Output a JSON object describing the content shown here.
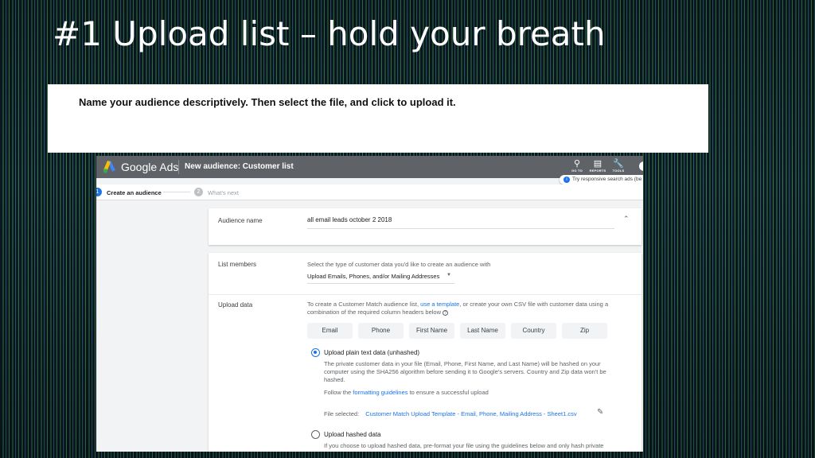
{
  "slide": {
    "title": "#1 Upload list – hold your breath",
    "instruction": "Name your audience descriptively.  Then select the file, and click to upload it."
  },
  "app": {
    "brand": "Google Ads",
    "page_title": "New audience: Customer list",
    "tools": [
      {
        "icon": "search-icon",
        "label": "GO TO"
      },
      {
        "icon": "reports-icon",
        "label": "REPORTS"
      },
      {
        "icon": "wrench-icon",
        "label": "TOOLS"
      }
    ],
    "tooltip": "Try responsive search ads (be"
  },
  "steps": {
    "step1_number": "1",
    "step1_label": "Create an audience",
    "step2_number": "2",
    "step2_label": "What's next"
  },
  "audience": {
    "label": "Audience name",
    "value": "all email leads october 2 2018"
  },
  "list_members": {
    "label": "List members",
    "hint": "Select the type of customer data you'd like to create an audience with",
    "selected": "Upload Emails, Phones, and/or Mailing Addresses"
  },
  "upload": {
    "label": "Upload data",
    "desc_part1": "To create a Customer Match audience list, ",
    "desc_link": "use a template",
    "desc_part2": ", or create your own CSV file with customer data using a combination of the required column headers below ",
    "help": "?",
    "columns": [
      "Email",
      "Phone",
      "First Name",
      "Last Name",
      "Country",
      "Zip"
    ],
    "option1_title": "Upload plain text data (unhashed)",
    "option1_desc": "The private customer data in your file (Email, Phone, First Name, and Last Name) will be hashed on your computer using the SHA256 algorithm before sending it to Google's servers. Country and Zip data won't be hashed.",
    "follow_part1": "Follow the ",
    "follow_link": "formatting guidelines",
    "follow_part2": " to ensure a successful upload",
    "file_label": "File selected:",
    "file_name": "Customer Match Upload Template - Email, Phone, Mailing Address - Sheet1.csv",
    "option2_title": "Upload hashed data",
    "option2_desc": "If you choose to upload hashed data, pre-format your file using the guidelines below and only hash private"
  }
}
